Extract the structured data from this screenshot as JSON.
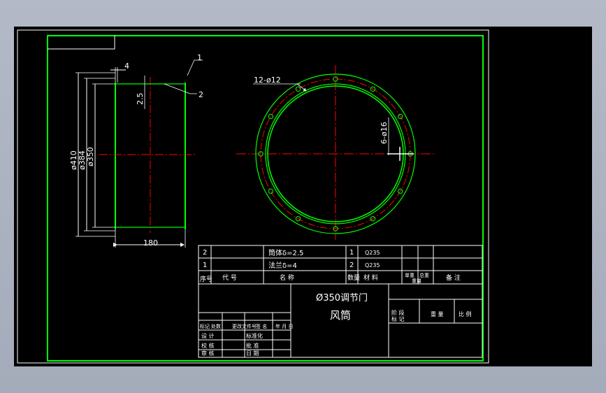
{
  "colors": {
    "background": "#000000",
    "border": "#00ff00",
    "part": "#00ff00",
    "centerline": "#ff0000",
    "dimension": "#ffffff",
    "window": "#a9b0be"
  },
  "side_view": {
    "dimensions": {
      "thickness": "4",
      "wall": "2.5",
      "dia_outer": "ø410",
      "dia_bolt": "ø384",
      "dia_inner": "ø350",
      "length": "180"
    },
    "leaders": {
      "part1": "1",
      "part2": "2"
    }
  },
  "front_view": {
    "flange_holes": "12-ø12",
    "damper_holes": "6-ø16"
  },
  "title_block": {
    "bom": [
      {
        "index": "2",
        "name": "筒体δ=2.5",
        "qty": "1",
        "material": "Q235"
      },
      {
        "index": "1",
        "name": "法兰δ=4",
        "qty": "2",
        "material": "Q235"
      }
    ],
    "bom_headers": {
      "seq": "序号",
      "code": "代 号",
      "name": "名 称",
      "qty": "数量",
      "material": "材 料",
      "unit_weight": "单重",
      "total_weight": "总重",
      "weight_label": "重量",
      "note": "备 注"
    },
    "title_line1": "Ø350调节门",
    "title_line2": "风筒",
    "stage_label": "阶 段",
    "marking": "标 记",
    "weight": "重 量",
    "scale": "比 例",
    "sheet_label": "张",
    "sign_row": [
      "标记",
      "处数",
      "分区",
      "更改文件号",
      "签 名",
      "年 月 日"
    ],
    "roles": [
      "设 计",
      "校 核",
      "审 核",
      "工 艺"
    ],
    "standard": "标准化",
    "approve": "批 准",
    "date_label": "日 期"
  }
}
